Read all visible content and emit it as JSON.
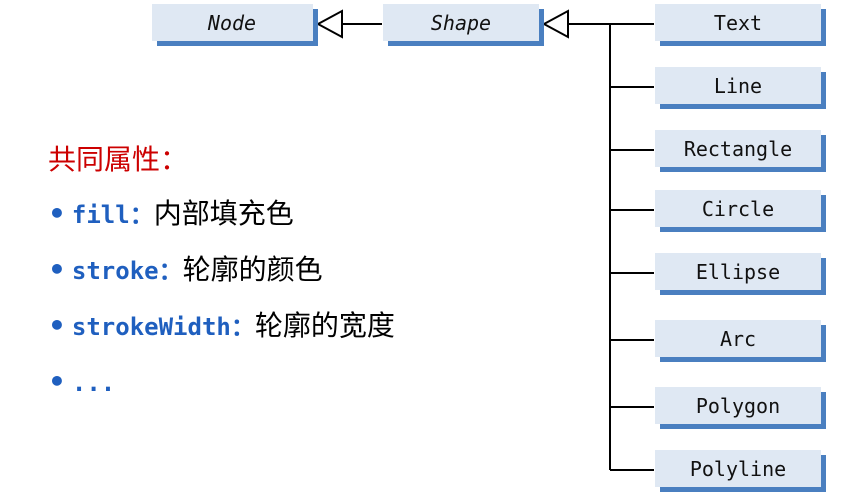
{
  "diagram": {
    "node": "Node",
    "shape": "Shape",
    "subclasses": [
      "Text",
      "Line",
      "Rectangle",
      "Circle",
      "Ellipse",
      "Arc",
      "Polygon",
      "Polyline"
    ]
  },
  "notes": {
    "title": "共同属性：",
    "items": [
      {
        "name": "fill",
        "separator": "：",
        "desc": "内部填充色"
      },
      {
        "name": "stroke",
        "separator": "：",
        "desc": "轮廓的颜色"
      },
      {
        "name": "strokeWidth",
        "separator": "：",
        "desc": "轮廓的宽度"
      },
      {
        "name": "...",
        "separator": "",
        "desc": ""
      }
    ]
  },
  "colors": {
    "box_fill": "#dfe8f3",
    "box_shadow": "#4a7fc0",
    "line": "#000000",
    "title_red": "#cc0000",
    "property_blue": "#1f5fbf"
  }
}
